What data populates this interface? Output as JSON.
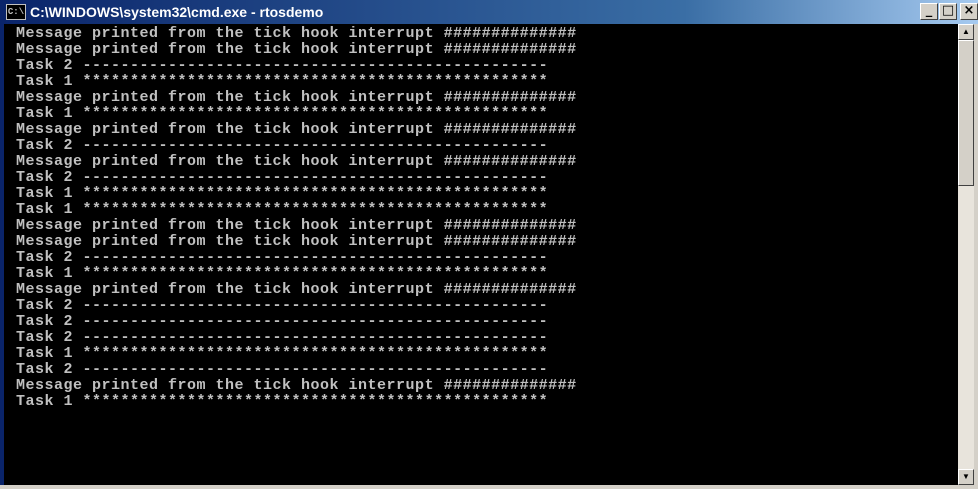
{
  "window": {
    "title": "C:\\WINDOWS\\system32\\cmd.exe - rtosdemo",
    "icon_label": "C:\\",
    "buttons": {
      "minimize": "_",
      "maximize": "□",
      "close": "×"
    }
  },
  "console": {
    "lines": [
      "Message printed from the tick hook interrupt ##############",
      "Message printed from the tick hook interrupt ##############",
      "Task 2 -------------------------------------------------",
      "Task 1 *************************************************",
      "Message printed from the tick hook interrupt ##############",
      "Task 1 *************************************************",
      "Message printed from the tick hook interrupt ##############",
      "Task 2 -------------------------------------------------",
      "Message printed from the tick hook interrupt ##############",
      "Task 2 -------------------------------------------------",
      "Task 1 *************************************************",
      "Task 1 *************************************************",
      "Message printed from the tick hook interrupt ##############",
      "Message printed from the tick hook interrupt ##############",
      "Task 2 -------------------------------------------------",
      "Task 1 *************************************************",
      "Message printed from the tick hook interrupt ##############",
      "Task 2 -------------------------------------------------",
      "Task 2 -------------------------------------------------",
      "Task 2 -------------------------------------------------",
      "Task 1 *************************************************",
      "Task 2 -------------------------------------------------",
      "Message printed from the tick hook interrupt ##############",
      "Task 1 *************************************************"
    ]
  },
  "scrollbar": {
    "up_arrow": "▲",
    "down_arrow": "▼"
  },
  "colors": {
    "titlebar": "#0a246a",
    "console_bg": "#000000",
    "console_text": "#c0c0c0"
  }
}
